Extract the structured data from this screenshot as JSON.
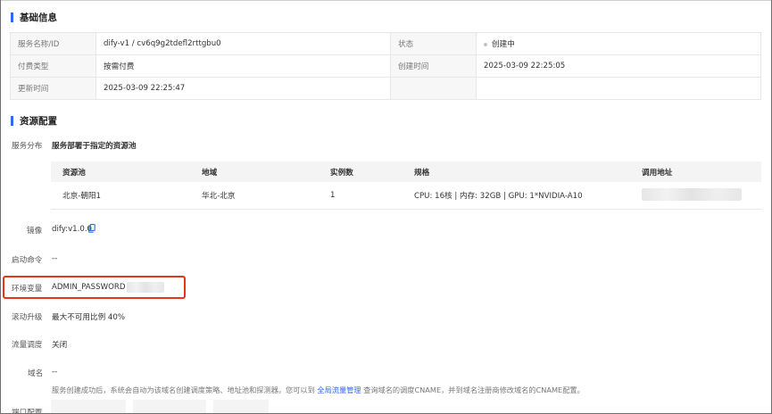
{
  "basic_info": {
    "title": "基础信息",
    "rows": [
      {
        "k1": "服务名称/ID",
        "v1": "dify-v1 / cv6q9g2tdefl2rttgbu0",
        "k2": "状态",
        "v2": "创建中"
      },
      {
        "k1": "付费类型",
        "v1": "按需付费",
        "k2": "创建时间",
        "v2": "2025-03-09 22:25:05"
      },
      {
        "k1": "更新时间",
        "v1": "2025-03-09 22:25:47",
        "k2": "",
        "v2": ""
      }
    ]
  },
  "resource_config": {
    "title": "资源配置",
    "service_distribution": {
      "label": "服务分布",
      "value": "服务部署于指定的资源池"
    },
    "pool_table": {
      "headers": [
        "资源池",
        "地域",
        "实例数",
        "规格",
        "调用地址"
      ],
      "rows": [
        {
          "pool": "北京-朝阳1",
          "region": "华北-北京",
          "instances": "1",
          "spec": "CPU: 16核 | 内存: 32GB | GPU: 1*NVIDIA-A10",
          "endpoint": ""
        }
      ]
    },
    "image": {
      "label": "镜像",
      "value": "dify:v1.0.0"
    },
    "start_command": {
      "label": "启动命令",
      "value": "--"
    },
    "env_vars": {
      "label": "环境变量",
      "value": "ADMIN_PASSWORD"
    },
    "rolling_upgrade": {
      "label": "滚动升级",
      "value": "最大不可用比例 40%"
    },
    "traffic_schedule": {
      "label": "流量调度",
      "value": "关闭"
    },
    "domain": {
      "label": "域名",
      "value": "--"
    },
    "note_before": "服务创建成功后，系统会自动为该域名创建调度策略、地址池和探测器。您可以到",
    "note_link": "全局流量管理",
    "note_after": "查询域名的调度CNAME，并到域名注册商修改域名的CNAME配置。",
    "port_config": {
      "label": "端口配置"
    }
  },
  "colors": {
    "accent": "#2f6bf0",
    "highlight_box": "#e8341f"
  }
}
